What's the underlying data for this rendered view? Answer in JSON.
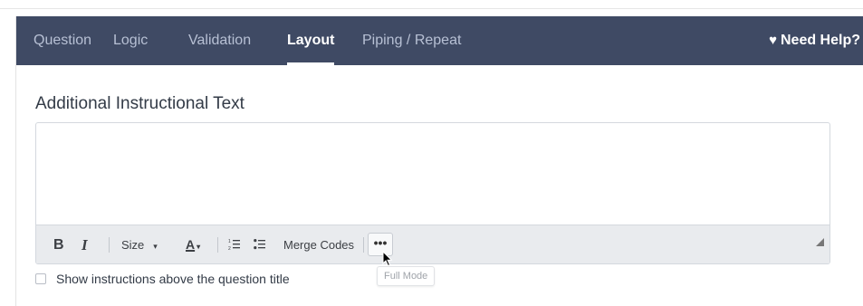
{
  "tabs": [
    {
      "label": "Question",
      "active": false
    },
    {
      "label": "Logic",
      "active": false
    },
    {
      "label": "Validation",
      "active": false
    },
    {
      "label": "Layout",
      "active": true
    },
    {
      "label": "Piping / Repeat",
      "active": false
    }
  ],
  "help": {
    "icon": "heart-icon",
    "label": "Need Help?"
  },
  "colors": {
    "tabbar": "#3f4a64",
    "tab_inactive": "#b7c0d4",
    "tab_active": "#ffffff",
    "toolbar": "#e9ebee"
  },
  "section": {
    "title": "Additional Instructional Text"
  },
  "editor": {
    "content": "",
    "toolbar": {
      "bold": "B",
      "italic": "I",
      "size_label": "Size",
      "size_caret": "▾",
      "font_color": "A",
      "color_caret": "▾",
      "ordered_list_icon": "ordered-list-icon",
      "unordered_list_icon": "unordered-list-icon",
      "merge_codes": "Merge Codes",
      "more": "•••",
      "resize_icon": "resize-handle-icon"
    },
    "tooltip": "Full Mode"
  },
  "checkbox": {
    "label": "Show instructions above the question title",
    "checked": false
  }
}
